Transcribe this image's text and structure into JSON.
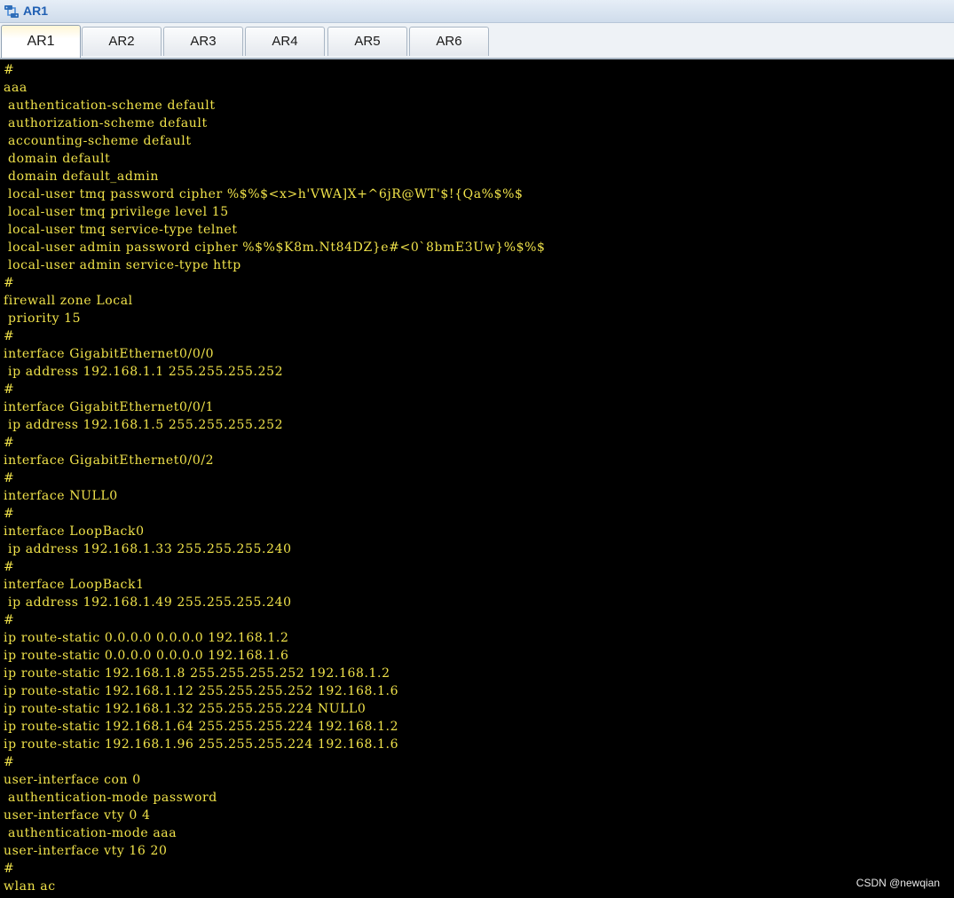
{
  "window": {
    "title": "AR1",
    "icon": "network-device-icon"
  },
  "tabs": [
    {
      "label": "AR1",
      "active": true
    },
    {
      "label": "AR2",
      "active": false
    },
    {
      "label": "AR3",
      "active": false
    },
    {
      "label": "AR4",
      "active": false
    },
    {
      "label": "AR5",
      "active": false
    },
    {
      "label": "AR6",
      "active": false
    }
  ],
  "console": {
    "text_color": "#f0e24a",
    "background_color": "#000000",
    "lines": [
      "#",
      "aaa",
      " authentication-scheme default",
      " authorization-scheme default",
      " accounting-scheme default",
      " domain default",
      " domain default_admin",
      " local-user tmq password cipher %$%$<x>h'VWA]X+^6jR@WT'$!{Qa%$%$",
      " local-user tmq privilege level 15",
      " local-user tmq service-type telnet",
      " local-user admin password cipher %$%$K8m.Nt84DZ}e#<0`8bmE3Uw}%$%$",
      " local-user admin service-type http",
      "#",
      "firewall zone Local",
      " priority 15",
      "#",
      "interface GigabitEthernet0/0/0",
      " ip address 192.168.1.1 255.255.255.252",
      "#",
      "interface GigabitEthernet0/0/1",
      " ip address 192.168.1.5 255.255.255.252",
      "#",
      "interface GigabitEthernet0/0/2",
      "#",
      "interface NULL0",
      "#",
      "interface LoopBack0",
      " ip address 192.168.1.33 255.255.255.240",
      "#",
      "interface LoopBack1",
      " ip address 192.168.1.49 255.255.255.240",
      "#",
      "ip route-static 0.0.0.0 0.0.0.0 192.168.1.2",
      "ip route-static 0.0.0.0 0.0.0.0 192.168.1.6",
      "ip route-static 192.168.1.8 255.255.255.252 192.168.1.2",
      "ip route-static 192.168.1.12 255.255.255.252 192.168.1.6",
      "ip route-static 192.168.1.32 255.255.255.224 NULL0",
      "ip route-static 192.168.1.64 255.255.255.224 192.168.1.2",
      "ip route-static 192.168.1.96 255.255.255.224 192.168.1.6",
      "#",
      "user-interface con 0",
      " authentication-mode password",
      "user-interface vty 0 4",
      " authentication-mode aaa",
      "user-interface vty 16 20",
      "#",
      "wlan ac",
      "#"
    ]
  },
  "watermark": "CSDN @newqian"
}
